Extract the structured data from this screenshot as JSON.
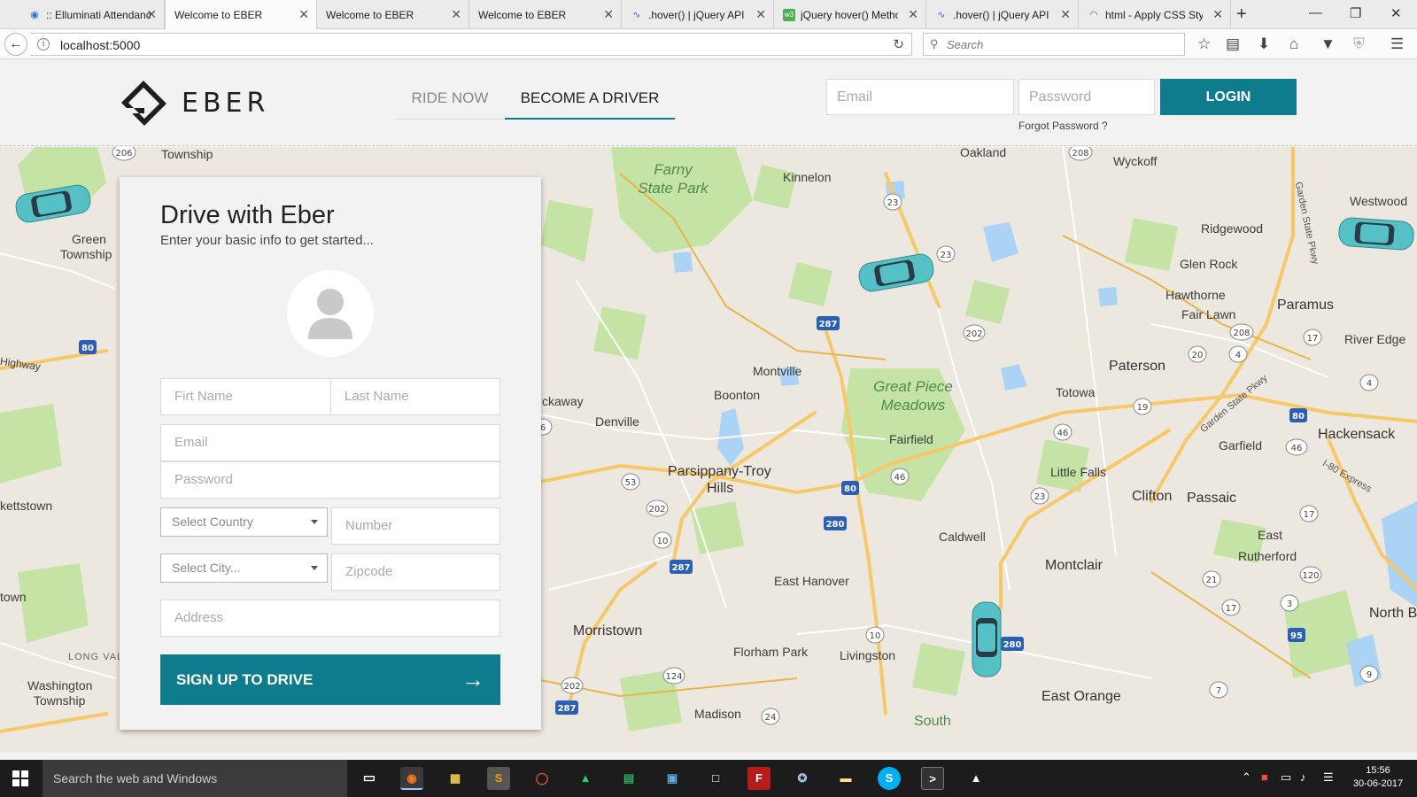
{
  "browser": {
    "tabs": [
      {
        "label": ":: Elluminati Attendance",
        "icon": "map-pin-icon",
        "active": false
      },
      {
        "label": "Welcome to EBER",
        "icon": "",
        "active": true
      },
      {
        "label": "Welcome to EBER",
        "icon": "",
        "active": false
      },
      {
        "label": "Welcome to EBER",
        "icon": "",
        "active": false
      },
      {
        "label": ".hover() | jQuery API Documentation",
        "icon": "jquery-icon",
        "active": false
      },
      {
        "label": "jQuery hover() Method",
        "icon": "w3schools-icon",
        "active": false
      },
      {
        "label": ".hover() | jQuery API Documentation",
        "icon": "jquery-icon",
        "active": false
      },
      {
        "label": "html - Apply CSS Style",
        "icon": "loading-icon",
        "active": false
      }
    ],
    "url": "localhost:5000",
    "search_placeholder": "Search"
  },
  "header": {
    "logo_text": "EBER",
    "nav": {
      "ride_now": "RIDE NOW",
      "become_driver": "BECOME A DRIVER"
    },
    "email_placeholder": "Email",
    "password_placeholder": "Password",
    "login_label": "LOGIN",
    "forgot_password": "Forgot Password ?"
  },
  "form": {
    "title": "Drive with Eber",
    "subtitle": "Enter your basic info to get started...",
    "first_name": "Firt Name",
    "last_name": "Last Name",
    "email": "Email",
    "password": "Password",
    "country": "Select Country",
    "number": "Number",
    "city": "Select City...",
    "zipcode": "Zipcode",
    "address": "Address",
    "submit": "SIGN UP TO DRIVE"
  },
  "map": {
    "labels": {
      "township": "Township",
      "green1": "Green",
      "green2": "Township",
      "highway": "Highway",
      "kettstown": "kettstown",
      "town": "town",
      "long_valley": "LONG VAL",
      "washington1": "Washington",
      "washington2": "Township",
      "ckaway": "ckaway",
      "farny1": "Farny",
      "farny2": "State Park",
      "kinnelon": "Kinnelon",
      "oakland": "Oakland",
      "wyckoff": "Wyckoff",
      "westwood": "Westwood",
      "ridgewood": "Ridgewood",
      "glen_rock": "Glen Rock",
      "hawthorne": "Hawthorne",
      "fair_lawn": "Fair Lawn",
      "paramus": "Paramus",
      "river_edge": "River Edge",
      "paterson": "Paterson",
      "totowa": "Totowa",
      "montville": "Montville",
      "boonton": "Boonton",
      "great_piece1": "Great Piece",
      "great_piece2": "Meadows",
      "denville": "Denville",
      "fairfield": "Fairfield",
      "little_falls": "Little Falls",
      "garfield": "Garfield",
      "hackensack": "Hackensack",
      "parsippany1": "Parsippany-Troy",
      "parsippany2": "Hills",
      "clifton": "Clifton",
      "passaic": "Passaic",
      "caldwell": "Caldwell",
      "east_rutherford1": "East",
      "east_rutherford2": "Rutherford",
      "montclair": "Montclair",
      "east_hanover": "East Hanover",
      "morristown": "Morristown",
      "florham_park": "Florham Park",
      "livingston": "Livingston",
      "north_b": "North B",
      "east_orange": "East Orange",
      "madison": "Madison",
      "south": "South",
      "garden_state": "Garden State Pkwy",
      "i80_express": "I-80 Express",
      "garden_state2": "Garden State Pkwy"
    },
    "shields": [
      "206",
      "208",
      "23",
      "23",
      "202",
      "287",
      "80",
      "17",
      "208",
      "20",
      "4",
      "4",
      "19",
      "46",
      "46",
      "80",
      "46",
      "53",
      "202",
      "10",
      "287",
      "80",
      "280",
      "23",
      "17",
      "21",
      "120",
      "17",
      "3",
      "95",
      "9",
      "10",
      "280",
      "124",
      "202",
      "287",
      "7",
      "24"
    ]
  },
  "taskbar": {
    "search_placeholder": "Search the web and Windows",
    "time": "15:56",
    "date": "30-06-2017"
  },
  "colors": {
    "accent": "#0e7c8c",
    "map_background": "#ece8df",
    "water": "#aad3f5",
    "park": "#c4e3a4",
    "highway": "#f7c86a"
  }
}
